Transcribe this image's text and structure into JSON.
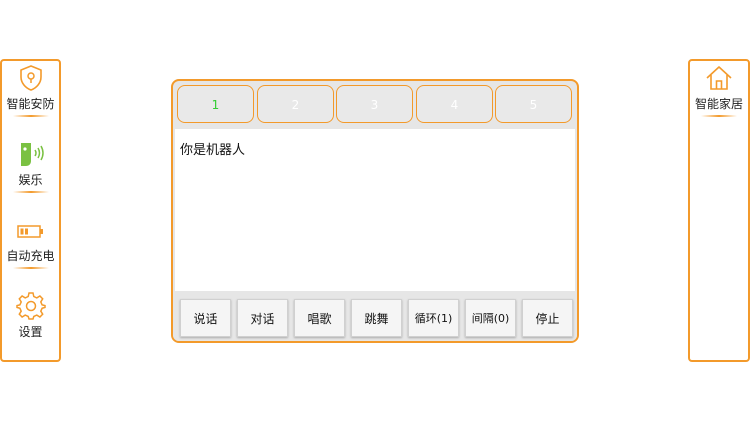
{
  "colors": {
    "accent": "#f39a2b",
    "active_tab": "#33cc33"
  },
  "left_nav": [
    {
      "label": "智能安防",
      "icon": "shield-icon"
    },
    {
      "label": "娱乐",
      "icon": "robot-voice-icon"
    },
    {
      "label": "自动充电",
      "icon": "battery-icon"
    },
    {
      "label": "设置",
      "icon": "gear-icon"
    }
  ],
  "right_nav": [
    {
      "label": "智能家居",
      "icon": "home-icon"
    }
  ],
  "tabs": [
    "1",
    "2",
    "3",
    "4",
    "5"
  ],
  "active_tab": "1",
  "text_content": "你是机器人",
  "buttons": [
    "说话",
    "对话",
    "唱歌",
    "跳舞",
    "循环(1)",
    "间隔(0)",
    "停止"
  ]
}
